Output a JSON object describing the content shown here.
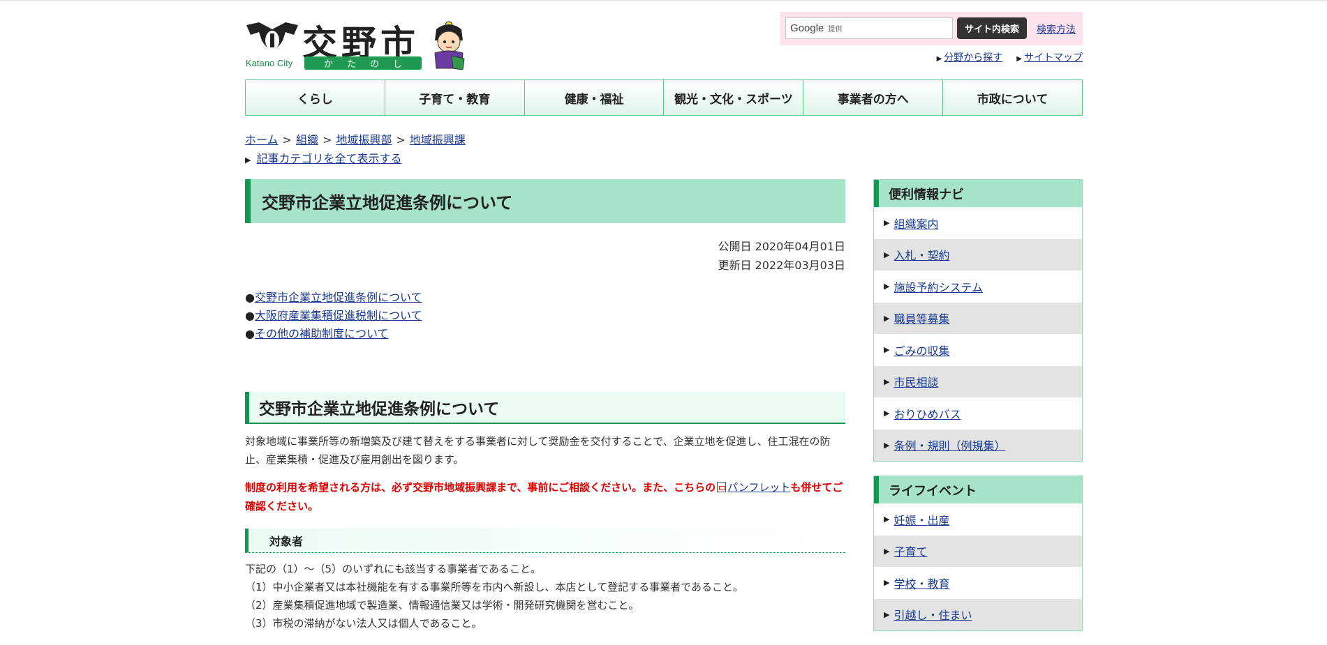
{
  "header": {
    "city_en": "Katano City",
    "city_jp": "交野市",
    "city_kana": [
      "か",
      "た",
      "の",
      "し"
    ],
    "search": {
      "google_label": "Google",
      "provided_label": "提供",
      "button_label": "サイト内検索",
      "help_link": "検索方法"
    },
    "sub_links": [
      "分野から探す",
      "サイトマップ"
    ]
  },
  "nav": [
    "くらし",
    "子育て・教育",
    "健康・福祉",
    "観光・文化・スポーツ",
    "事業者の方へ",
    "市政について"
  ],
  "breadcrumb": {
    "items": [
      "ホーム",
      "組織",
      "地域振興部",
      "地域振興課"
    ],
    "separator": ">",
    "show_categories": "記事カテゴリを全て表示する"
  },
  "main": {
    "title": "交野市企業立地促進条例について",
    "published": "公開日 2020年04月01日",
    "updated": "更新日 2022年03月03日",
    "anchor_bullet": "●",
    "anchors": [
      "交野市企業立地促進条例について",
      "大阪府産業集積促進税制について",
      "その他の補助制度について"
    ],
    "section_title": "交野市企業立地促進条例について",
    "intro": "対象地域に事業所等の新増築及び建て替えをする事業者に対して奨励金を交付することで、企業立地を促進し、住工混在の防止、産業集積・促進及び雇用創出を図ります。",
    "notice_before": "制度の利用を希望される方は、必ず交野市地域振興課まで、事前にご相談ください。また、こちらの",
    "notice_link": "パンフレット",
    "notice_after": "も併せてご確認ください。",
    "subsection_title": "対象者",
    "conditions": [
      "下記の（1）～（5）のいずれにも該当する事業者であること。",
      "（1）中小企業者又は本社機能を有する事業所等を市内へ新設し、本店として登記する事業者であること。",
      "（2）産業集積促進地域で製造業、情報通信業又は学術・開発研究機関を営むこと。",
      "（3）市税の滞納がない法人又は個人であること。"
    ]
  },
  "side": {
    "navi": {
      "title": "便利情報ナビ",
      "items": [
        "組織案内",
        "入札・契約",
        "施設予約システム",
        "職員等募集",
        "ごみの収集",
        "市民相談",
        "おりひめバス",
        "条例・規則（例規集）"
      ]
    },
    "life": {
      "title": "ライフイベント",
      "items": [
        "妊娠・出産",
        "子育て",
        "学校・教育",
        "引越し・住まい"
      ]
    }
  },
  "colors": {
    "accent_green": "#139654",
    "title_bg": "#a6e3c8",
    "notice_red": "#e00000",
    "link_blue": "#1a3a8f"
  }
}
